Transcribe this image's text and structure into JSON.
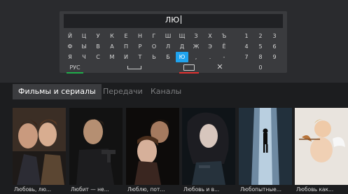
{
  "search": {
    "query": "ЛЮ"
  },
  "keyboard": {
    "rows": [
      [
        "Й",
        "Ц",
        "У",
        "К",
        "Е",
        "Н",
        "Г",
        "Ш",
        "Щ",
        "З",
        "Х",
        "Ъ",
        "1",
        "2",
        "3"
      ],
      [
        "Ф",
        "Ы",
        "В",
        "А",
        "П",
        "Р",
        "О",
        "Л",
        "Д",
        "Ж",
        "Э",
        "Ё",
        "4",
        "5",
        "6"
      ],
      [
        "Я",
        "Ч",
        "С",
        "М",
        "И",
        "Т",
        "Ь",
        "Б",
        "Ю",
        ",",
        ".",
        "-",
        "7",
        "8",
        "9"
      ]
    ],
    "active_key": "Ю",
    "lang_label": "РУС",
    "zero_label": "0",
    "space_icon": "space-icon",
    "backspace_icon": "backspace-icon",
    "close_icon": "close-icon",
    "accent_green": "#1fae4a",
    "accent_red": "#e0312f",
    "accent_blue": "#1fa3ee"
  },
  "tabs": [
    {
      "label": "Фильмы и сериалы",
      "active": true
    },
    {
      "label": "Передачи",
      "active": false
    },
    {
      "label": "Каналы",
      "active": false
    }
  ],
  "results": [
    {
      "title": "Любовь, лю..."
    },
    {
      "title": "Любит — не..."
    },
    {
      "title": "Люблю, пот..."
    },
    {
      "title": "Любовь и в..."
    },
    {
      "title": "Любопытные..."
    },
    {
      "title": "Любовь как..."
    }
  ]
}
